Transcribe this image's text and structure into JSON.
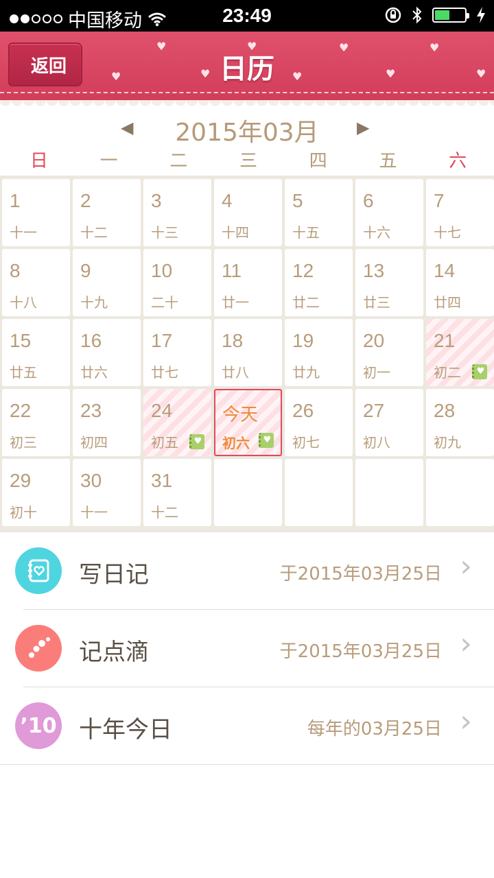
{
  "status_bar": {
    "carrier": "中国移动",
    "time": "23:49",
    "signal_dots_filled": 2,
    "signal_dots_total": 5,
    "battery_level": 0.5
  },
  "nav": {
    "back_label": "返回",
    "title": "日历"
  },
  "calendar": {
    "month_label": "2015年03月",
    "weekdays": [
      "日",
      "一",
      "二",
      "三",
      "四",
      "五",
      "六"
    ],
    "accent_color": "#e04a5c",
    "today_color": "#f08a3c",
    "days": [
      {
        "num": "1",
        "lunar": "十一"
      },
      {
        "num": "2",
        "lunar": "十二"
      },
      {
        "num": "3",
        "lunar": "十三"
      },
      {
        "num": "4",
        "lunar": "十四"
      },
      {
        "num": "5",
        "lunar": "十五"
      },
      {
        "num": "6",
        "lunar": "十六"
      },
      {
        "num": "7",
        "lunar": "十七"
      },
      {
        "num": "8",
        "lunar": "十八"
      },
      {
        "num": "9",
        "lunar": "十九"
      },
      {
        "num": "10",
        "lunar": "二十"
      },
      {
        "num": "11",
        "lunar": "廿一"
      },
      {
        "num": "12",
        "lunar": "廿二"
      },
      {
        "num": "13",
        "lunar": "廿三"
      },
      {
        "num": "14",
        "lunar": "廿四"
      },
      {
        "num": "15",
        "lunar": "廿五"
      },
      {
        "num": "16",
        "lunar": "廿六"
      },
      {
        "num": "17",
        "lunar": "廿七"
      },
      {
        "num": "18",
        "lunar": "廿八"
      },
      {
        "num": "19",
        "lunar": "廿九"
      },
      {
        "num": "20",
        "lunar": "初一"
      },
      {
        "num": "21",
        "lunar": "初二",
        "marked": true,
        "note": true
      },
      {
        "num": "22",
        "lunar": "初三"
      },
      {
        "num": "23",
        "lunar": "初四"
      },
      {
        "num": "24",
        "lunar": "初五",
        "marked": true,
        "note": true
      },
      {
        "num": "今天",
        "lunar": "初六",
        "today": true,
        "note": true
      },
      {
        "num": "26",
        "lunar": "初七"
      },
      {
        "num": "27",
        "lunar": "初八"
      },
      {
        "num": "28",
        "lunar": "初九"
      },
      {
        "num": "29",
        "lunar": "初十"
      },
      {
        "num": "30",
        "lunar": "十一"
      },
      {
        "num": "31",
        "lunar": "十二"
      },
      {
        "num": "",
        "lunar": ""
      },
      {
        "num": "",
        "lunar": ""
      },
      {
        "num": "",
        "lunar": ""
      },
      {
        "num": "",
        "lunar": ""
      }
    ]
  },
  "list": [
    {
      "name": "diary",
      "label": "写日记",
      "value": "于2015年03月25日",
      "icon": "notebook-heart-icon",
      "icon_text": "",
      "color": "#4fd5e0"
    },
    {
      "name": "moments",
      "label": "记点滴",
      "value": "于2015年03月25日",
      "icon": "dots-icon",
      "icon_text": "",
      "color": "#fb7d7a"
    },
    {
      "name": "ten-years",
      "label": "十年今日",
      "value": "每年的03月25日",
      "icon": "ten-years-icon",
      "icon_text": "’10",
      "color": "#e09ad8"
    }
  ]
}
